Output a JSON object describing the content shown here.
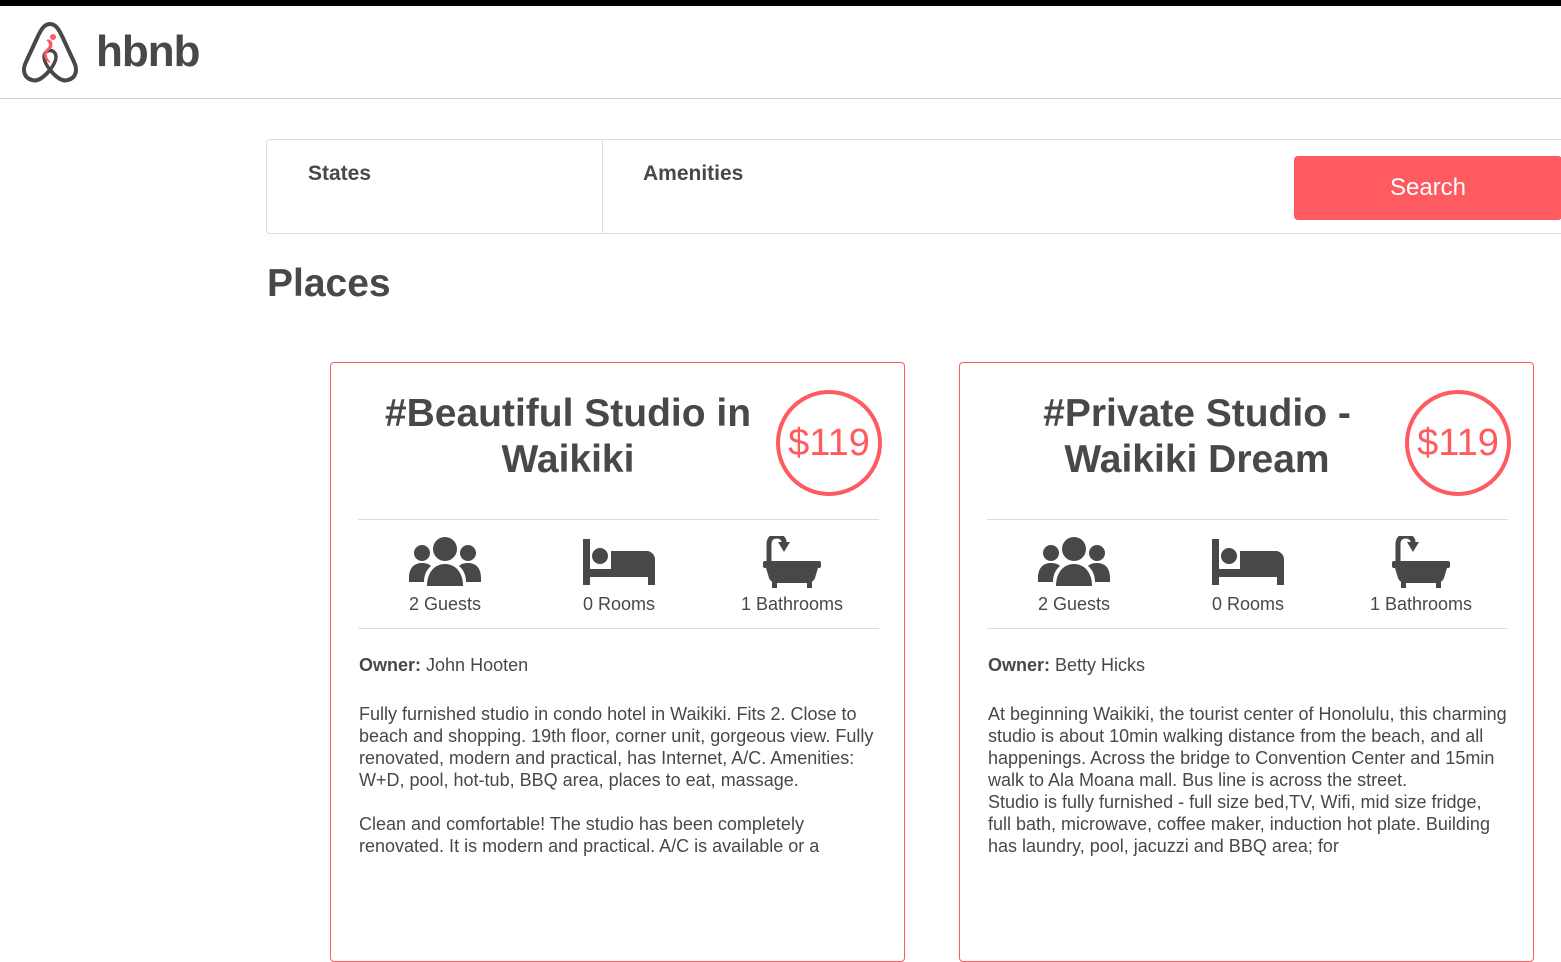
{
  "app": {
    "logo_text": "hbnb"
  },
  "filters": {
    "states_label": "States",
    "amenities_label": "Amenities",
    "search_label": "Search"
  },
  "places": {
    "title": "Places",
    "items": [
      {
        "title": "#Beautiful Studio in Waikiki",
        "price": "$119",
        "guests": "2 Guests",
        "rooms": "0 Rooms",
        "bathrooms": "1 Bathrooms",
        "owner_label": "Owner:",
        "owner_name": "John Hooten",
        "description_1": "Fully furnished studio in condo hotel in Waikiki. Fits 2. Close to beach and shopping. 19th floor, corner unit, gorgeous view. Fully renovated, modern and practical, has Internet, A/C. Amenities: W+D, pool, hot-tub, BBQ area, places to eat, massage.",
        "description_2": "Clean and comfortable! The studio has been completely renovated. It is modern and practical. A/C is available or a"
      },
      {
        "title": "#Private Studio - Waikiki Dream",
        "price": "$119",
        "guests": "2 Guests",
        "rooms": "0 Rooms",
        "bathrooms": "1 Bathrooms",
        "owner_label": "Owner:",
        "owner_name": "Betty Hicks",
        "description_1": "At beginning Waikiki, the tourist center of Honolulu, this charming studio is about 10min walking distance from the beach, and all happenings. Across the bridge to Convention Center and 15min walk to Ala Moana mall. Bus line is across the street.",
        "description_2": "Studio is fully furnished - full size bed,TV, Wifi, mid size fridge, full bath, microwave, coffee maker, induction hot plate. Building has laundry, pool, jacuzzi and BBQ area; for"
      }
    ]
  },
  "colors": {
    "brand": "#ff5a5f",
    "text": "#484848",
    "border": "#dddddd"
  },
  "icons": {
    "logo": "airbnb-logo-icon",
    "guests": "users-icon",
    "rooms": "bed-icon",
    "bathrooms": "bath-icon"
  }
}
